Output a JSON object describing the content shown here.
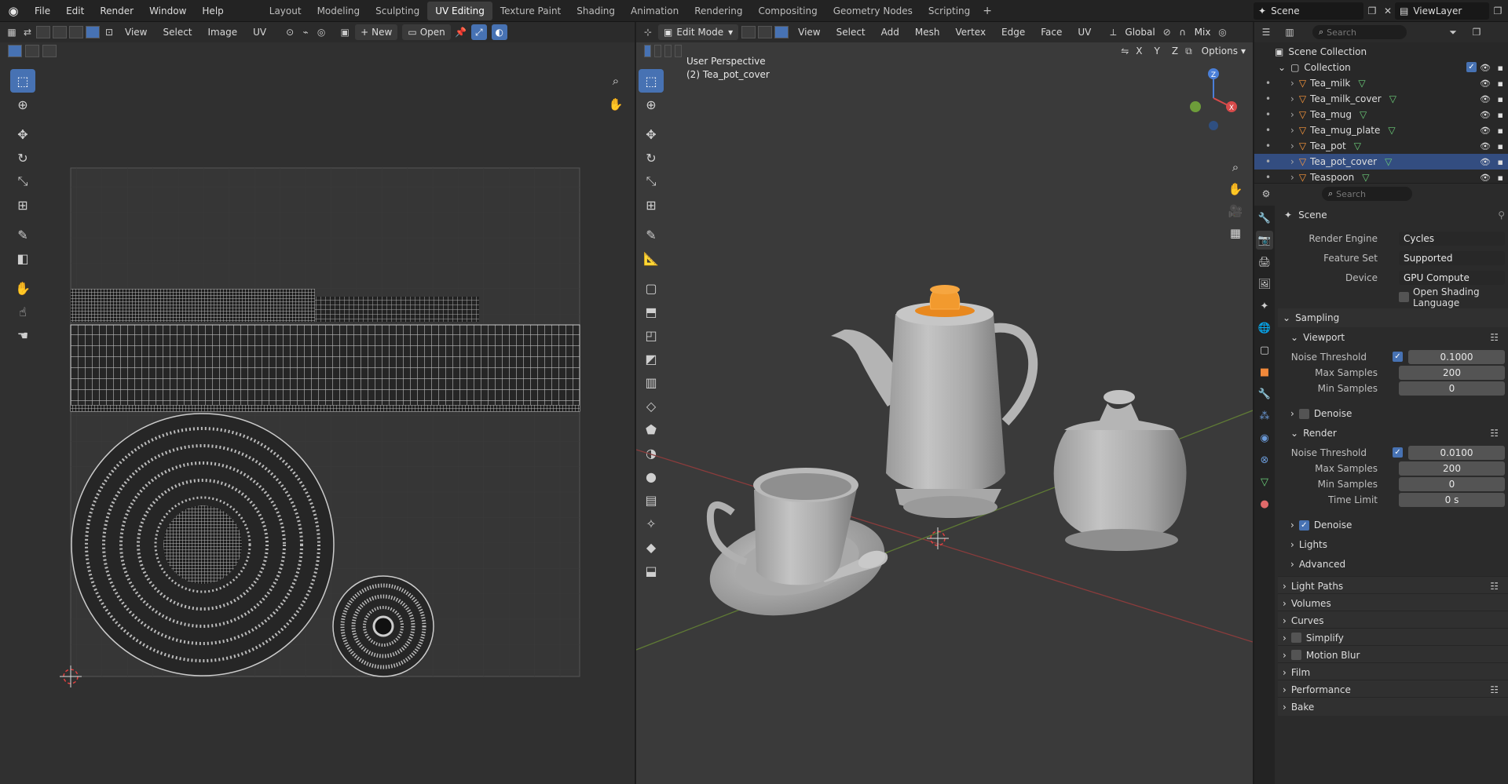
{
  "menu": [
    "File",
    "Edit",
    "Render",
    "Window",
    "Help"
  ],
  "workspaces": [
    "Layout",
    "Modeling",
    "Sculpting",
    "UV Editing",
    "Texture Paint",
    "Shading",
    "Animation",
    "Rendering",
    "Compositing",
    "Geometry Nodes",
    "Scripting"
  ],
  "active_workspace": "UV Editing",
  "scene": "Scene",
  "view_layer": "ViewLayer",
  "uv_editor": {
    "menus": [
      "View",
      "Select",
      "Image",
      "UV"
    ],
    "new_label": "New",
    "open_label": "Open"
  },
  "viewport": {
    "mode": "Edit Mode",
    "menus": [
      "View",
      "Select",
      "Add",
      "Mesh",
      "Vertex",
      "Edge",
      "Face",
      "UV"
    ],
    "orientation": "Global",
    "shading": "Mix",
    "options_label": "Options",
    "axes": [
      "X",
      "Y",
      "Z"
    ],
    "perspective": "User Perspective",
    "object_label": "(2) Tea_pot_cover",
    "gizmo": {
      "z": "Z",
      "x": "X"
    }
  },
  "outliner": {
    "search_placeholder": "Search",
    "root": "Scene Collection",
    "collection": "Collection",
    "objects": [
      "Tea_milk",
      "Tea_milk_cover",
      "Tea_mug",
      "Tea_mug_plate",
      "Tea_pot",
      "Tea_pot_cover",
      "Teaspoon"
    ],
    "selected": "Tea_pot_cover"
  },
  "properties": {
    "search_placeholder": "Search",
    "context": "Scene",
    "render_engine_label": "Render Engine",
    "render_engine": "Cycles",
    "feature_set_label": "Feature Set",
    "feature_set": "Supported",
    "device_label": "Device",
    "device": "GPU Compute",
    "osl_label": "Open Shading Language",
    "sampling": "Sampling",
    "viewport": "Viewport",
    "render": "Render",
    "noise_threshold_label": "Noise Threshold",
    "viewport_noise": "0.1000",
    "render_noise": "0.0100",
    "max_samples_label": "Max Samples",
    "min_samples_label": "Min Samples",
    "time_limit_label": "Time Limit",
    "viewport_max": "200",
    "viewport_min": "0",
    "render_max": "200",
    "render_min": "0",
    "time_limit": "0 s",
    "denoise": "Denoise",
    "lights": "Lights",
    "advanced": "Advanced",
    "panels": [
      "Light Paths",
      "Volumes",
      "Curves",
      "Simplify",
      "Motion Blur",
      "Film",
      "Performance",
      "Bake"
    ]
  }
}
